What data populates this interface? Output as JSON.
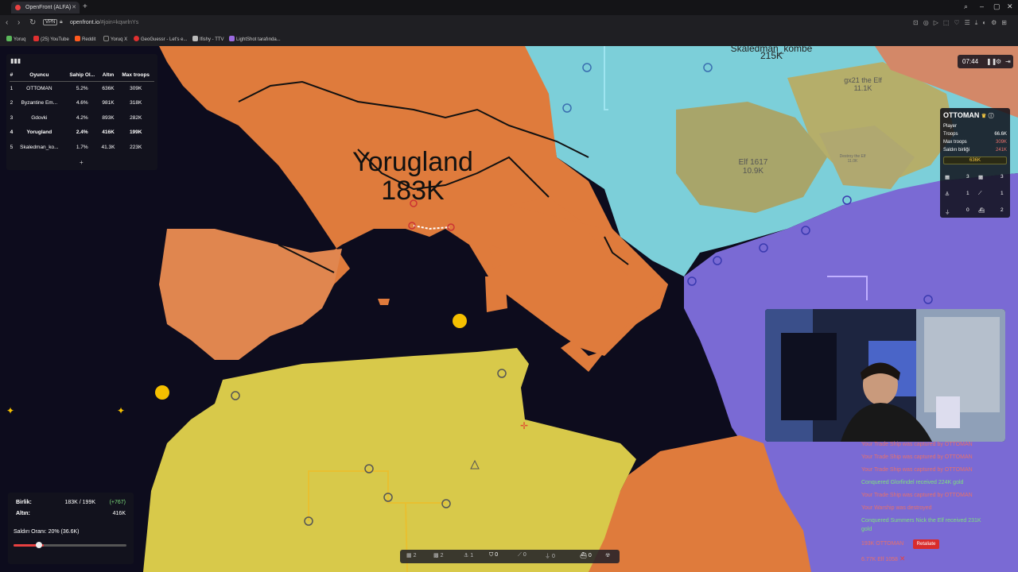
{
  "browser": {
    "tab_title": "OpenFront (ALFA)",
    "url": "openfront.io",
    "url_suffix": "/#join=kqwrlnYs",
    "vpn": "VPN",
    "bookmarks": [
      "Yoruq",
      "(25) YouTube",
      "Reddit",
      "Yoruq X",
      "GeoGuessr - Let's e...",
      "Ifishy - TTV",
      "LightShot tarafında..."
    ]
  },
  "leaderboard": {
    "headers": [
      "#",
      "Oyuncu",
      "Sahip Ol...",
      "Altın",
      "Max troops"
    ],
    "rows": [
      [
        "1",
        "OTTOMAN",
        "5.2%",
        "636K",
        "309K"
      ],
      [
        "2",
        "Byzantine Em...",
        "4.6%",
        "981K",
        "318K"
      ],
      [
        "3",
        "Gdovki",
        "4.2%",
        "893K",
        "282K"
      ],
      [
        "4",
        "Yorugland",
        "2.4%",
        "416K",
        "199K"
      ],
      [
        "5",
        "Skaledman_ko...",
        "1.7%",
        "41.3K",
        "223K"
      ]
    ],
    "more": "+"
  },
  "map_labels": {
    "main_name": "Yorugland",
    "main_troops": "183K",
    "skaledman_name": "Skaledman_kombe",
    "skaledman_troops": "215K",
    "gx21_name": "gx21 the Elf",
    "gx21_troops": "11.1K",
    "elf_name": "Elf 1617",
    "elf_troops": "10.9K",
    "destroy_name": "Destroy the Elf",
    "destroy_troops": "11.0K"
  },
  "timer": {
    "time": "07:44"
  },
  "player_panel": {
    "name": "OTTOMAN",
    "type": "Player",
    "troops_label": "Troops",
    "troops": "66.6K",
    "max_troops_label": "Max troops",
    "max_troops": "309K",
    "alliance_label": "Saldırı birliği",
    "alliance": "241K",
    "gold": "636K",
    "stats": [
      "3",
      "3",
      "1",
      "1",
      "0",
      "2"
    ]
  },
  "events": [
    {
      "text": "Your Trade Ship was captured by OTTOMAN",
      "color": "#e8706a"
    },
    {
      "text": "Your Trade Ship was captured by OTTOMAN",
      "color": "#e8706a"
    },
    {
      "text": "Your Trade Ship was captured by OTTOMAN",
      "color": "#e8706a"
    },
    {
      "text": "Conquered Glorfindel received 224K gold",
      "color": "#7de07d"
    },
    {
      "text": "Your Trade Ship was captured by OTTOMAN",
      "color": "#e8706a"
    },
    {
      "text": "Your Warship was destroyed",
      "color": "#e8706a"
    },
    {
      "text": "Conquered Summers Nick the Elf received 231K",
      "color": "#7de07d"
    },
    {
      "text": "gold",
      "color": "#7de07d"
    },
    {
      "text": "193K OTTOMAN",
      "color": "#e8706a"
    },
    {
      "text": "6.77K Elf 1058",
      "color": "#e8706a"
    }
  ],
  "retaliate": "Retaliate",
  "stats": {
    "troops_label": "Birlik:",
    "troops_value": "183K / 199K",
    "troops_delta": "(+767)",
    "gold_label": "Altın:",
    "gold_value": "416K",
    "attack_ratio": "Saldırı Oranı: 20% (36.6K)",
    "attack_ratio_value": 0.2
  },
  "bottom_bar": [
    "2",
    "2",
    "1",
    "0",
    "0",
    "0",
    "0"
  ],
  "colors": {
    "sea": "#0d0c1d",
    "orange": "#df7b3c",
    "yellow": "#d8c94a",
    "cyan": "#7ccfd9",
    "purple": "#7a6ad4",
    "olive": "#b5ae6a"
  }
}
